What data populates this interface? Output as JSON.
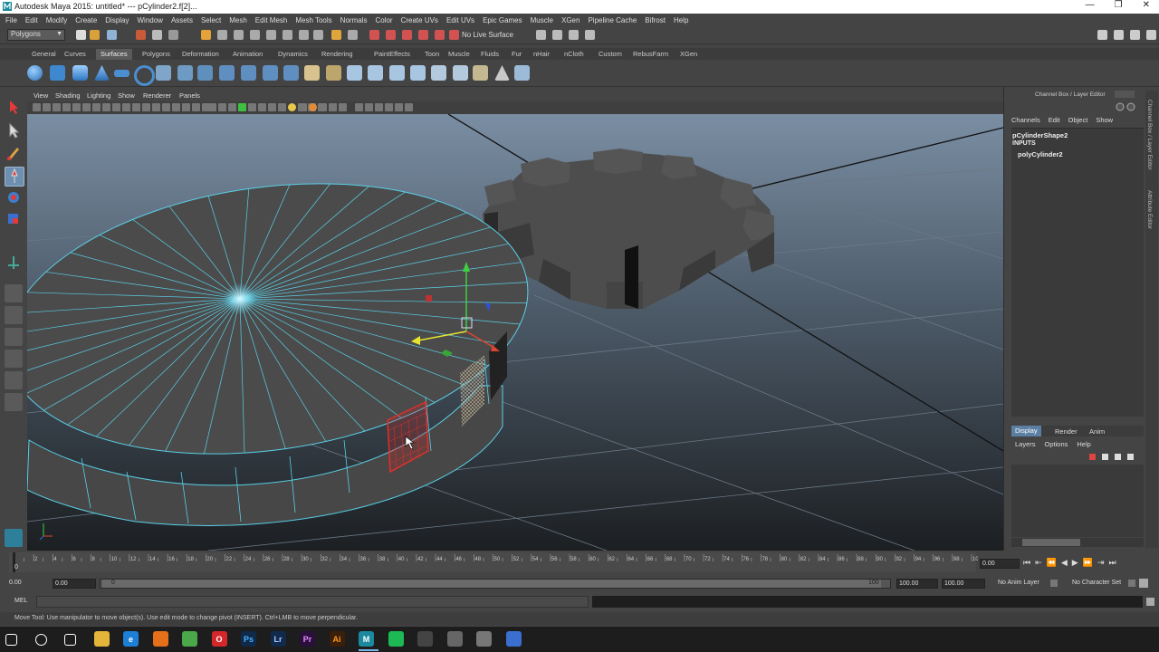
{
  "window": {
    "title": "Autodesk Maya 2015: untitled*   ---   pCylinder2.f[2]...",
    "controls": [
      "—",
      "❐",
      "✕"
    ]
  },
  "menubar": [
    "File",
    "Edit",
    "Modify",
    "Create",
    "Display",
    "Window",
    "Assets",
    "Select",
    "Mesh",
    "Edit Mesh",
    "Mesh Tools",
    "Normals",
    "Color",
    "Create UVs",
    "Edit UVs",
    "Epic Games",
    "Muscle",
    "XGen",
    "Pipeline Cache",
    "Bifrost",
    "Help"
  ],
  "statusline": {
    "mode": "Polygons",
    "live_surface": "No Live Surface"
  },
  "shelf": {
    "tabs": [
      "General",
      "Curves",
      "Surfaces",
      "Polygons",
      "Deformation",
      "Animation",
      "Dynamics",
      "Rendering",
      "PaintEffects",
      "Toon",
      "Muscle",
      "Fluids",
      "Fur",
      "nHair",
      "nCloth",
      "Custom",
      "RebusFarm",
      "XGen"
    ],
    "active_tab": "Surfaces"
  },
  "viewport": {
    "menu": [
      "View",
      "Shading",
      "Lighting",
      "Show",
      "Renderer",
      "Panels"
    ]
  },
  "channel_box": {
    "title": "Channel Box / Layer Editor",
    "menu": [
      "Channels",
      "Edit",
      "Object",
      "Show"
    ],
    "shape_name": "pCylinderShape2",
    "inputs_label": "INPUTS",
    "input_node": "polyCylinder2",
    "side_tabs": [
      "Channel Box / Layer Editor",
      "Attribute Editor"
    ]
  },
  "layer_editor": {
    "tabs": [
      "Display",
      "Render",
      "Anim"
    ],
    "active_tab": "Display",
    "menu": [
      "Layers",
      "Options",
      "Help"
    ]
  },
  "timeline": {
    "ticks": [
      "2",
      "4",
      "6",
      "8",
      "10",
      "12",
      "14",
      "16",
      "18",
      "20",
      "22",
      "24",
      "26",
      "28",
      "30",
      "32",
      "34",
      "36",
      "38",
      "40",
      "42",
      "44",
      "46",
      "48",
      "50",
      "52",
      "54",
      "56",
      "58",
      "60",
      "62",
      "64",
      "66",
      "68",
      "70",
      "72",
      "74",
      "76",
      "78",
      "80",
      "82",
      "84",
      "86",
      "88",
      "90",
      "92",
      "94",
      "96",
      "98",
      "100"
    ],
    "start_tick": "0",
    "current_frame": "0.00"
  },
  "range": {
    "start": "0.00",
    "playback_start": "0.00",
    "slider_start": "0",
    "slider_end": "100",
    "playback_end": "100.00",
    "end": "100.00",
    "anim_layer": "No Anim Layer",
    "character_set": "No Character Set"
  },
  "mel": {
    "label": "MEL"
  },
  "help_line": "Move Tool: Use manipulator to move object(s). Use edit mode to change pivot (INSERT).  Ctrl+LMB to move perpendicular.",
  "taskbar": {
    "apps": [
      {
        "name": "start-icon",
        "glyph": ""
      },
      {
        "name": "search-icon",
        "glyph": ""
      },
      {
        "name": "task-view-icon",
        "glyph": ""
      },
      {
        "name": "file-explorer-icon",
        "glyph": ""
      },
      {
        "name": "edge-icon",
        "glyph": "e"
      },
      {
        "name": "firefox-icon",
        "glyph": ""
      },
      {
        "name": "chrome-icon",
        "glyph": ""
      },
      {
        "name": "opera-icon",
        "glyph": "O"
      },
      {
        "name": "photoshop-icon",
        "glyph": "Ps"
      },
      {
        "name": "lightroom-icon",
        "glyph": "Lr"
      },
      {
        "name": "premiere-icon",
        "glyph": "Pr"
      },
      {
        "name": "illustrator-icon",
        "glyph": "Ai"
      },
      {
        "name": "maya-icon",
        "glyph": "M"
      },
      {
        "name": "spotify-icon",
        "glyph": ""
      },
      {
        "name": "calculator-icon",
        "glyph": ""
      },
      {
        "name": "app-icon",
        "glyph": ""
      },
      {
        "name": "app2-icon",
        "glyph": ""
      },
      {
        "name": "notepad-icon",
        "glyph": ""
      }
    ]
  },
  "colors": {
    "accent": "#5a7fa3",
    "selected_face": "#e0302a",
    "wireframe": "#5ad0e8"
  }
}
